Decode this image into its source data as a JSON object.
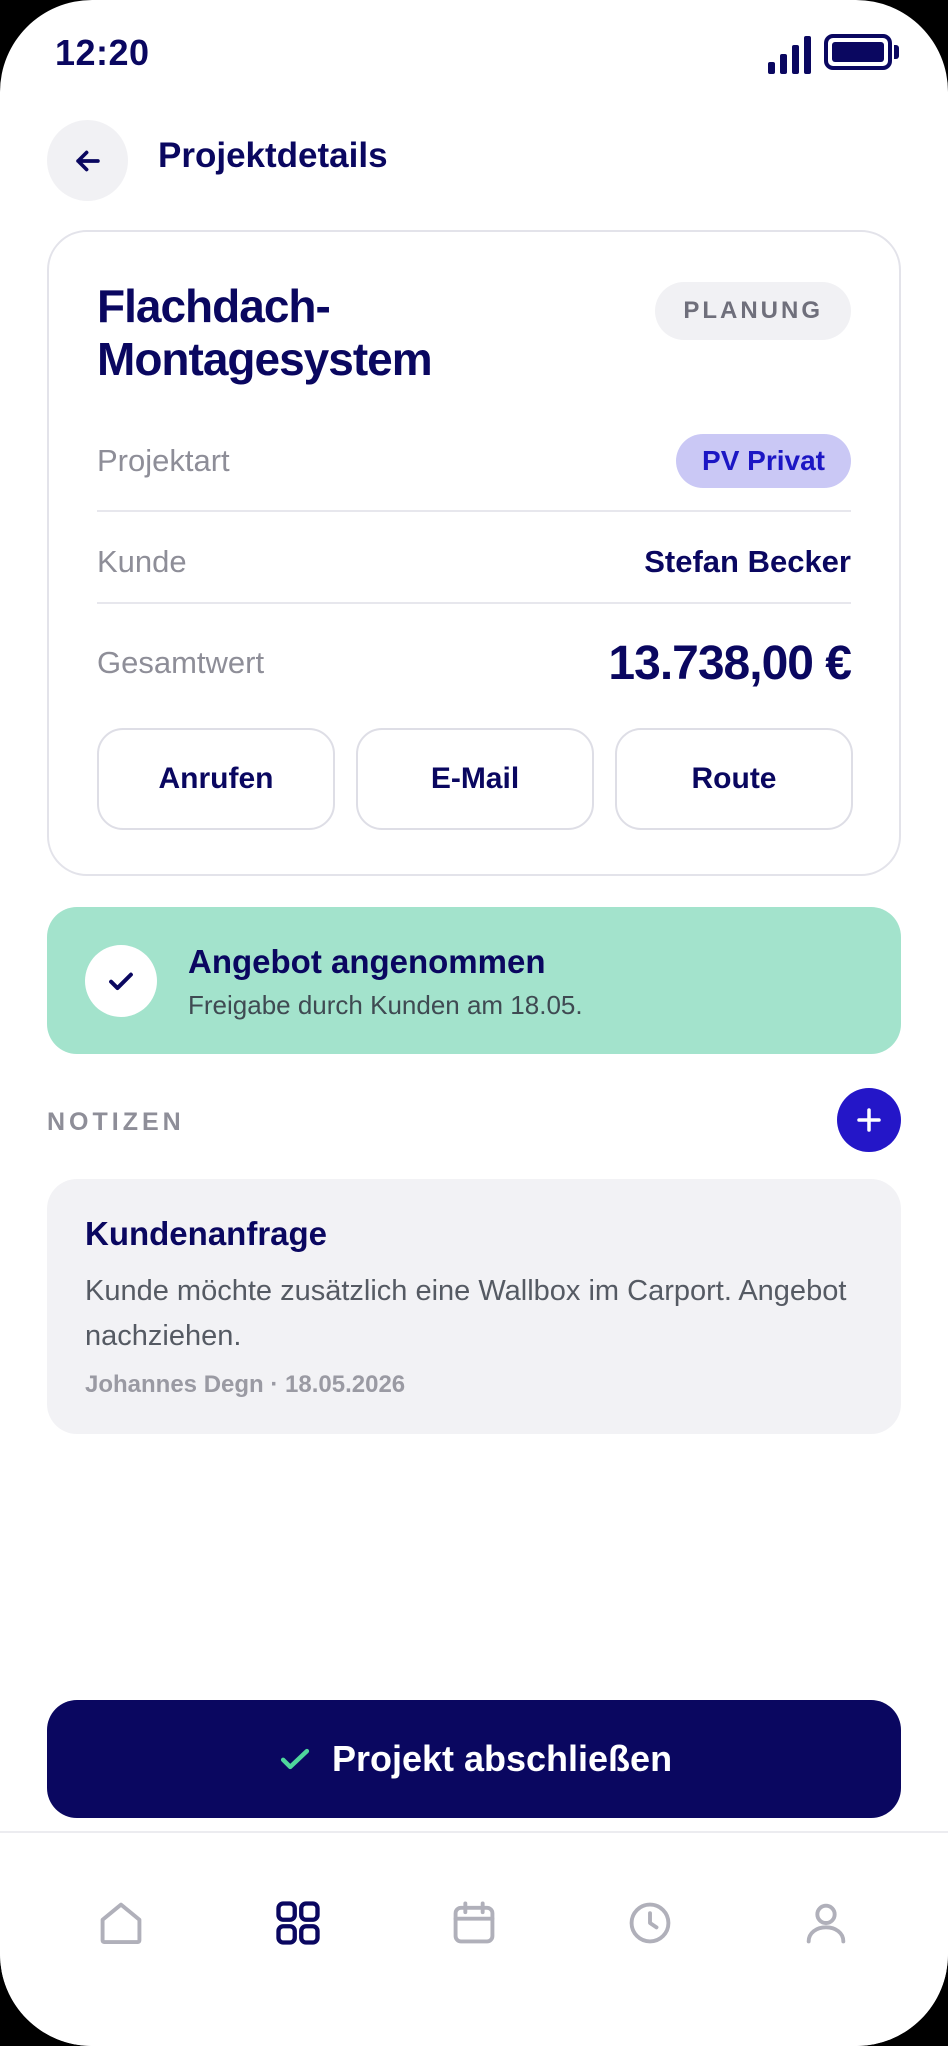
{
  "status_bar": {
    "time": "12:20"
  },
  "header": {
    "title": "Projektdetails"
  },
  "project": {
    "name": "Flachdach-Montagesystem",
    "status": "PLANUNG",
    "type_label": "Projektart",
    "type_value": "PV Privat",
    "customer_label": "Kunde",
    "customer_value": "Stefan Becker",
    "total_label": "Gesamtwert",
    "total_value": "13.738,00 €",
    "actions": {
      "call": "Anrufen",
      "email": "E-Mail",
      "route": "Route"
    }
  },
  "banner": {
    "title": "Angebot angenommen",
    "subtitle": "Freigabe durch Kunden am 18.05."
  },
  "notes": {
    "section_label": "NOTIZEN",
    "items": [
      {
        "title": "Kundenanfrage",
        "body": "Kunde möchte zusätzlich eine Wallbox im Carport. Angebot nachziehen.",
        "meta": "Johannes Degn · 18.05.2026"
      }
    ]
  },
  "primary_action": {
    "label": "Projekt abschließen"
  },
  "tabs": [
    {
      "icon": "home-icon",
      "active": false
    },
    {
      "icon": "grid-icon",
      "active": true
    },
    {
      "icon": "calendar-icon",
      "active": false
    },
    {
      "icon": "clock-icon",
      "active": false
    },
    {
      "icon": "user-icon",
      "active": false
    }
  ],
  "colors": {
    "primary": "#0a0760",
    "accent": "#2416c8",
    "success_bg": "#a3e3cc",
    "type_badge_bg": "#cac8f5"
  }
}
